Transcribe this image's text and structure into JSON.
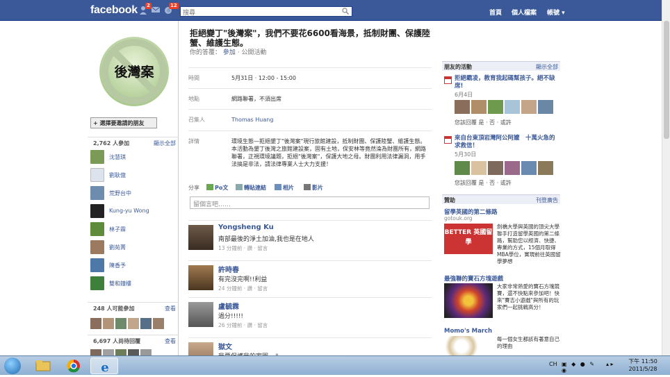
{
  "topbar": {
    "logo": "facebook",
    "friend_requests_count": "2",
    "notifications_count": "12",
    "search_placeholder": "搜尋",
    "nav": {
      "home": "首頁",
      "profile": "個人檔案",
      "account": "帳號"
    }
  },
  "left": {
    "invite_button": "+ 選擇要邀請的朋友",
    "attending_header": "2,762 人參加",
    "see_all": "顯示全部",
    "guests": [
      "沈慧琪",
      "劉耿億",
      "荒野台中",
      "Kung-yu Wong",
      "林子霖",
      "劉苑菁",
      "陳香予",
      "雙和鐘樓"
    ],
    "maybe_header": "248 人可能參加",
    "maybe_link": "查看",
    "awaiting_header": "6,697 人尚待回覆",
    "awaiting_link": "查看"
  },
  "event": {
    "title": "拒絕變丁\"後灣案\"，我們不要花6600看海景，抵制財團、保護陸蟹、維護生態。",
    "your_answer_label": "你的答覆：",
    "your_answer": "參加",
    "visibility": "· 公開活動",
    "rows": [
      {
        "key": "時間",
        "value": "5月31日 · 12:00 - 15:00"
      },
      {
        "key": "地點",
        "value": "網路聯署，不須出席"
      },
      {
        "key": "召集人",
        "value": "Thomas Huang"
      },
      {
        "key": "詳情",
        "value": "環境生態—拒絕墾丁\"後灣案\"現行旅館建設，抵制財團、保護陸蟹、維護生態。本活動為墾丁後灣之旅館建設案，固有土地，保安林等竟然淪為財團所有，網路聯署，正視環境議題，拒絕\"後灣案\"，保護大地之母。財團利用法律漏洞，用手法搞是非法，請法律專業人士大力支援！"
      }
    ],
    "share": {
      "label": "分享",
      "items": [
        "Po文",
        "轉貼連結",
        "相片",
        "影片"
      ]
    },
    "comment_placeholder": "留個言吧……"
  },
  "posts": [
    {
      "author": "Yongsheng Ku",
      "text": "南部最後的淨土加油,我也是在地人",
      "meta": "13 分鐘前 · 讚 · 留言"
    },
    {
      "author": "許時春",
      "text": "有完沒完啊!!利益",
      "meta": "24 分鐘前 · 讚 · 留言"
    },
    {
      "author": "盧毓霖",
      "text": "過分!!!!!",
      "meta": "26 分鐘前 · 讚 · 留言"
    },
    {
      "author": "獄文",
      "text": "我要保護我的家園~ \"~",
      "meta": ""
    }
  ],
  "right": {
    "friends_events_header": "朋友的活動",
    "show_all": "顯示全部",
    "events": [
      {
        "title": "拒絕霸凌，教育我起碼幫孩子。絕不缺席!",
        "date": "6月4日",
        "rsvp": "您該回覆 是 · 否 · 或許"
      },
      {
        "title": "來自台東頂岩灣阿公阿嬤　十萬火急的求救信！",
        "date": "5月30日",
        "rsvp": "您該回覆 是 · 否 · 或許"
      }
    ],
    "sponsored_header": "贊助",
    "create_ad": "刊登廣告",
    "ads": [
      {
        "title": "留學英國的第二條路",
        "source": "gotouk.org",
        "img_text": "BETTER 英國留學",
        "desc": "劍橋大學與英國的頂尖大學聯手打造留學英國的第二條路，幫助您以經濟、快捷、專業的方式，15個月取得MBA學位，實現前往英國留學夢想"
      },
      {
        "title": "最強聯的寶石方塊遊戲",
        "source": "",
        "desc": "大家非常熱愛的寶石方塊競賽，還不快點來參加吧！快來\"賽吉小遊戲\"與所有的玩家們一起挑戰高分！"
      },
      {
        "title": "Momo's March",
        "source": "",
        "desc": "每一個女生都該有著意自己的理由"
      }
    ]
  },
  "taskbar": {
    "lang": "CH",
    "time": "下午 11:50",
    "date": "2011/5/28"
  }
}
